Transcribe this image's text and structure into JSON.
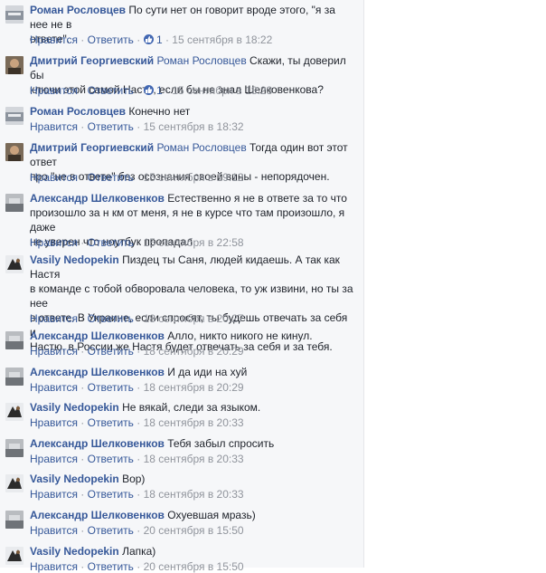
{
  "comments": [
    {
      "author": "Роман Рословцев",
      "avatar": "gray",
      "mention": "",
      "lines": [
        "По сути нет он говорит вроде этого, \"я за нее не в",
        "ответе\"."
      ],
      "like": "Нравится",
      "reply": "Ответить",
      "likes": "1",
      "time": "15 сентября в 18:22"
    },
    {
      "author": "Дмитрий Георгиевский",
      "avatar": "photo-brown",
      "mention": "Роман Рословцев",
      "lines": [
        "Скажи, ты доверил бы",
        "ключи этой самой Насте, если бы не знал Шелковенкова?"
      ],
      "like": "Нравится",
      "reply": "Ответить",
      "likes": "1",
      "time": "15 сентября в 18:23"
    },
    {
      "author": "Роман Рословцев",
      "avatar": "gray",
      "mention": "",
      "lines": [
        "Конечно нет"
      ],
      "like": "Нравится",
      "reply": "Ответить",
      "likes": "",
      "time": "15 сентября в 18:32"
    },
    {
      "author": "Дмитрий Георгиевский",
      "avatar": "photo-brown",
      "mention": "Роман Рословцев",
      "lines": [
        "Тогда один вот этот ответ",
        "про \"не в ответе\" без осознания своей вины - непорядочен."
      ],
      "like": "Нравится",
      "reply": "Ответить",
      "likes": "",
      "time": "15 сентября в 19:12"
    },
    {
      "author": "Александр Шелковенков",
      "avatar": "photo-gray",
      "mention": "",
      "lines": [
        "Естественно я не в ответе за то что",
        "произошло за н км от меня, я не в курсе что там произошло, я даже",
        "не уверен что ноутбук пропадал"
      ],
      "like": "Нравится",
      "reply": "Ответить",
      "likes": "",
      "time": "15 сентября в 22:58"
    },
    {
      "author": "Vasily Nedopekin",
      "avatar": "photo-dark",
      "mention": "",
      "lines": [
        "Пиздец ты Саня, людей кидаешь. А так как Настя",
        "в команде с тобой обворовала человека, то уж извини, но ты за нее",
        "в ответе. В Украине, если спросят, ты будешь отвечать за себя и",
        "Настю, в России же Настя будет отвечать за себя и за тебя."
      ],
      "like": "Нравится",
      "reply": "Ответить",
      "likes": "",
      "time": "18 сентября в 20:27"
    },
    {
      "author": "Александр Шелковенков",
      "avatar": "photo-gray",
      "mention": "",
      "lines": [
        "Алло, никто никого не кинул."
      ],
      "like": "Нравится",
      "reply": "Ответить",
      "likes": "",
      "time": "18 сентября в 20:29"
    },
    {
      "author": "Александр Шелковенков",
      "avatar": "photo-gray",
      "mention": "",
      "lines": [
        "И да иди на хуй"
      ],
      "like": "Нравится",
      "reply": "Ответить",
      "likes": "",
      "time": "18 сентября в 20:29"
    },
    {
      "author": "Vasily Nedopekin",
      "avatar": "photo-dark",
      "mention": "",
      "lines": [
        "Не вякай, следи за языком."
      ],
      "like": "Нравится",
      "reply": "Ответить",
      "likes": "",
      "time": "18 сентября в 20:33"
    },
    {
      "author": "Александр Шелковенков",
      "avatar": "photo-gray",
      "mention": "",
      "lines": [
        "Тебя забыл спросить"
      ],
      "like": "Нравится",
      "reply": "Ответить",
      "likes": "",
      "time": "18 сентября в 20:33"
    },
    {
      "author": "Vasily Nedopekin",
      "avatar": "photo-dark",
      "mention": "",
      "lines": [
        "Вор)"
      ],
      "like": "Нравится",
      "reply": "Ответить",
      "likes": "",
      "time": "18 сентября в 20:33"
    },
    {
      "author": "Александр Шелковенков",
      "avatar": "photo-gray",
      "mention": "",
      "lines": [
        "Охуевшая мразь)"
      ],
      "like": "Нравится",
      "reply": "Ответить",
      "likes": "",
      "time": "20 сентября в 15:50"
    },
    {
      "author": "Vasily Nedopekin",
      "avatar": "photo-dark",
      "mention": "",
      "lines": [
        "Лапка)"
      ],
      "like": "Нравится",
      "reply": "Ответить",
      "likes": "",
      "time": "20 сентября в 15:50"
    }
  ]
}
